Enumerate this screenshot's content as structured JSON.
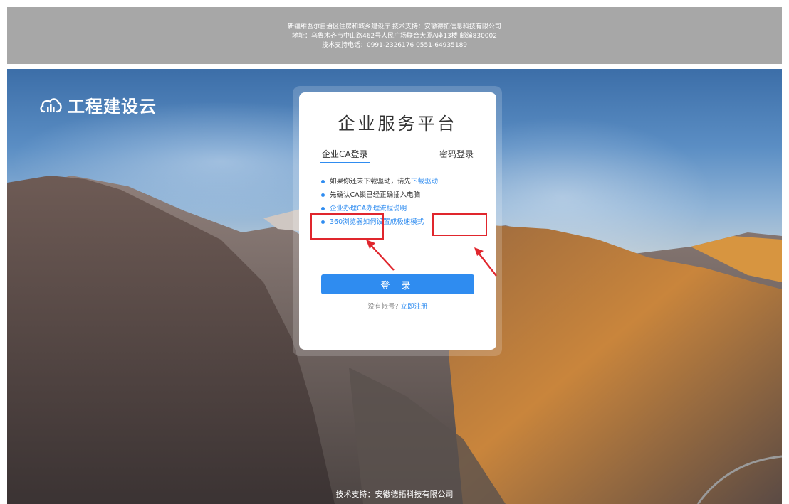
{
  "banner": {
    "line1": "新疆维吾尔自治区住房和城乡建设厅 技术支持：安徽德拓信息科技有限公司",
    "line2": "地址：乌鲁木齐市中山路462号人民广场联合大厦A座13楼 邮编830002",
    "line3": "技术支持电话：0991-2326176 0551-64935189"
  },
  "logo": {
    "icon": "cloud-icon",
    "text": "工程建设云"
  },
  "card": {
    "title": "企业服务平台",
    "tab_ca": "企业CA登录",
    "tab_pwd": "密码登录",
    "tips": [
      {
        "pre": "如果你还未下载驱动，请先",
        "link": "下载驱动"
      },
      {
        "text": "先确认CA锁已经正确插入电脑"
      },
      {
        "text": "企业办理CA办理流程说明"
      },
      {
        "text": "360浏览器如何设置成极速模式"
      }
    ],
    "login_label": "登 录",
    "register_prompt": "没有帐号?",
    "register_link": "立即注册"
  },
  "footer": {
    "text": "技术支持：安徽德拓科技有限公司"
  },
  "colors": {
    "accent": "#2f8cf0",
    "highlight": "#e0262d",
    "banner": "#a7a7a7"
  }
}
